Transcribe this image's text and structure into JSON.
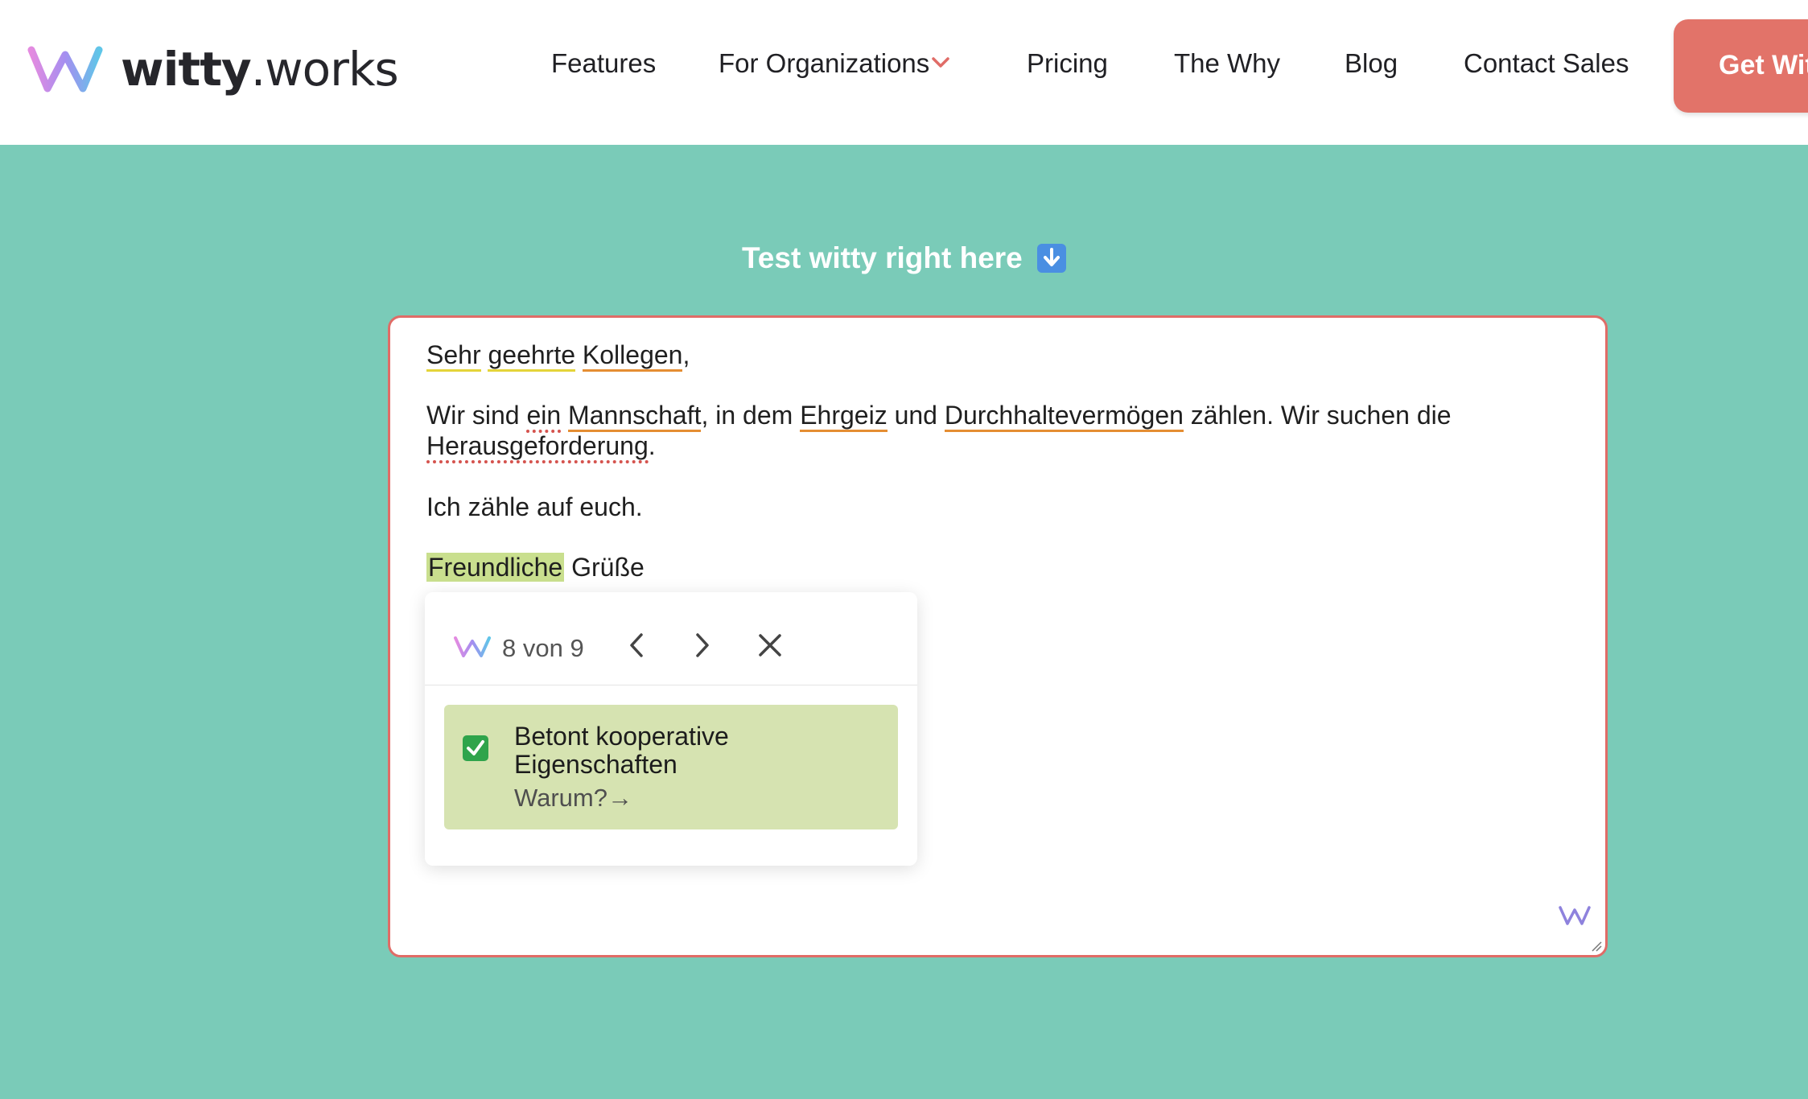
{
  "brand": {
    "name_bold": "witty",
    "name_rest": ".works"
  },
  "nav": {
    "items": [
      "Features",
      "For Organizations",
      "Pricing",
      "The Why",
      "Blog",
      "Contact Sales"
    ],
    "cta_label": "Get Witty"
  },
  "hero": {
    "title": "Test witty right here"
  },
  "editor": {
    "greeting": {
      "w1": "Sehr",
      "w2": "geehrte",
      "w3": "Kollegen",
      "punct": ","
    },
    "para1": {
      "t1": "Wir sind ",
      "w_ein": "ein",
      "sp1": " ",
      "w_mannschaft": "Mannschaft",
      "t2": ", in dem ",
      "w_ehrgeiz": "Ehrgeiz",
      "t3": " und ",
      "w_durchhalt": "Durchhaltevermögen",
      "t4": " zählen. Wir suchen die",
      "w_heraus": "Herausgeforderung",
      "t5": "."
    },
    "para2": "Ich zähle auf euch.",
    "closing": {
      "w1": "Freundliche",
      "w2": " Grüße"
    }
  },
  "popup": {
    "count": "8 von 9",
    "suggestion_title": "Betont kooperative Eigenschaften",
    "suggestion_link": "Warum?→"
  },
  "colors": {
    "background": "#7acbb8",
    "cta": "#e27369",
    "editor_border": "#e06c67",
    "highlight_green": "#c9df8e",
    "suggestion_bg": "#d6e3b1",
    "underline_orange": "#e58e33",
    "underline_yellow": "#e4d43a",
    "underline_red": "#d5534e"
  },
  "icons": [
    "witty-logo-icon",
    "chevron-down-icon",
    "arrow-down-icon",
    "chevron-left-icon",
    "chevron-right-icon",
    "close-icon",
    "checkmark-icon",
    "resize-handle-icon"
  ]
}
